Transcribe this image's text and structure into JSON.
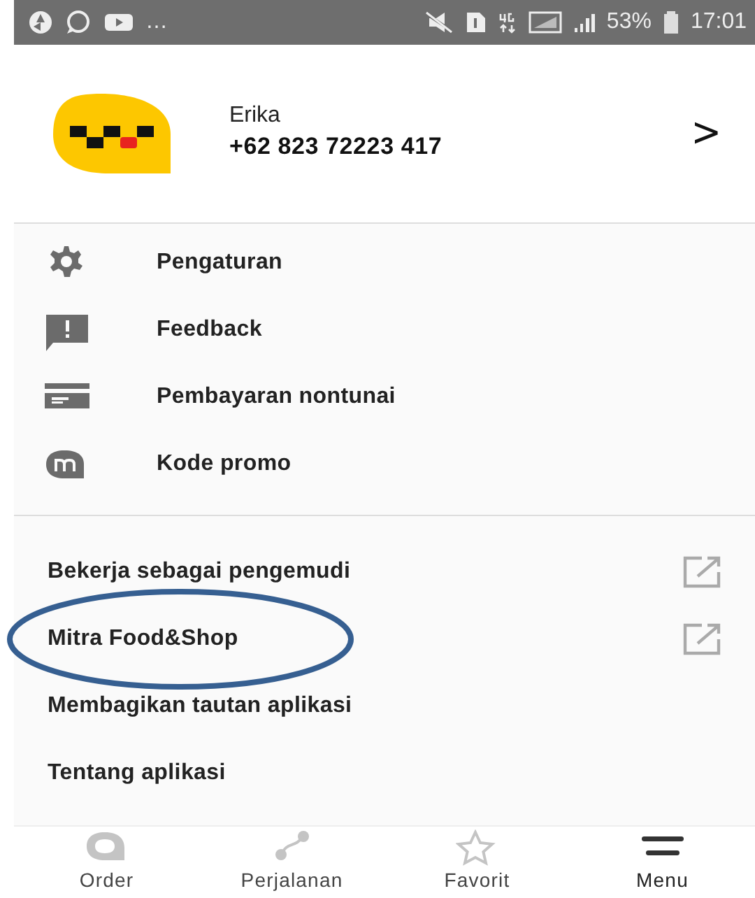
{
  "status_bar": {
    "more": "…",
    "battery": "53%",
    "time": "17:01"
  },
  "profile": {
    "name": "Erika",
    "phone": "+62 823 72223 417",
    "chevron": ">"
  },
  "menu_primary": [
    {
      "label": "Pengaturan",
      "kind": "settings"
    },
    {
      "label": "Feedback",
      "kind": "feedback"
    },
    {
      "label": "Pembayaran nontunai",
      "kind": "card"
    },
    {
      "label": "Kode promo",
      "kind": "promo"
    }
  ],
  "menu_secondary": [
    {
      "label": "Bekerja sebagai pengemudi",
      "external": true
    },
    {
      "label": "Mitra Food&Shop",
      "external": true
    },
    {
      "label": "Membagikan tautan aplikasi",
      "external": false
    },
    {
      "label": "Tentang aplikasi",
      "external": false
    }
  ],
  "bottom_nav": [
    {
      "label": "Order",
      "kind": "order",
      "selected": false
    },
    {
      "label": "Perjalanan",
      "kind": "route",
      "selected": false
    },
    {
      "label": "Favorit",
      "kind": "star",
      "selected": false
    },
    {
      "label": "Menu",
      "kind": "menu",
      "selected": true
    }
  ]
}
